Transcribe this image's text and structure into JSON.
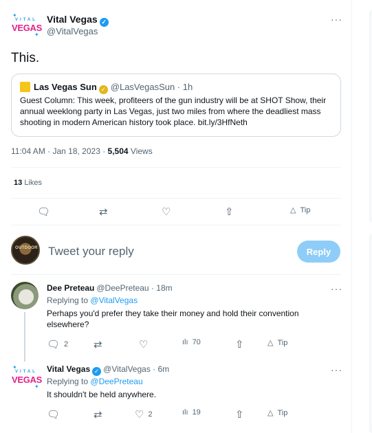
{
  "tweet": {
    "author_name": "Vital Vegas",
    "author_handle": "@VitalVegas",
    "logo_top": "VITAL",
    "logo_bottom": "VEGAS",
    "text": "This.",
    "time": "11:04 AM · Jan 18, 2023",
    "views_count": "5,504",
    "views_label": "Views",
    "likes_count": "13",
    "likes_label": "Likes"
  },
  "quote": {
    "name": "Las Vegas Sun",
    "handle": "@LasVegasSun · 1h",
    "text": "Guest Column: This week, profiteers of the gun industry will be at SHOT Show, their annual weeklong party in Las Vegas, just two miles from where the deadliest mass shooting in modern American history took place. bit.ly/3HfNeth"
  },
  "actions": {
    "tip_label": "Tip"
  },
  "composer": {
    "placeholder": "Tweet your reply",
    "reply_button": "Reply",
    "avatar_text": "OUTDOOR"
  },
  "replies": [
    {
      "name": "Dee Preteau",
      "handle": "@DeePreteau · 18m",
      "replying_label": "Replying to",
      "replying_to": "@VitalVegas",
      "text": "Perhaps you'd prefer they take their money and hold their convention elsewhere?",
      "reply_count": "2",
      "retweet_count": "",
      "like_count": "",
      "views_count": "70",
      "tip_label": "Tip"
    },
    {
      "name": "Vital Vegas",
      "handle": "@VitalVegas · 6m",
      "replying_label": "Replying to",
      "replying_to": "@DeePreteau",
      "text": "It shouldn't be held anywhere.",
      "reply_count": "",
      "retweet_count": "",
      "like_count": "2",
      "views_count": "19",
      "tip_label": "Tip"
    }
  ],
  "colors": {
    "accent": "#1d9bf0",
    "reply_button": "#8ecdf8",
    "brand_pink": "#e0218a",
    "verified_gold": "#e2b719"
  },
  "icons": {
    "reply": "speech-bubble-icon",
    "retweet": "retweet-icon",
    "like": "heart-icon",
    "share": "share-icon",
    "views": "bar-chart-icon",
    "tip": "tip-icon",
    "more": "more-icon"
  }
}
